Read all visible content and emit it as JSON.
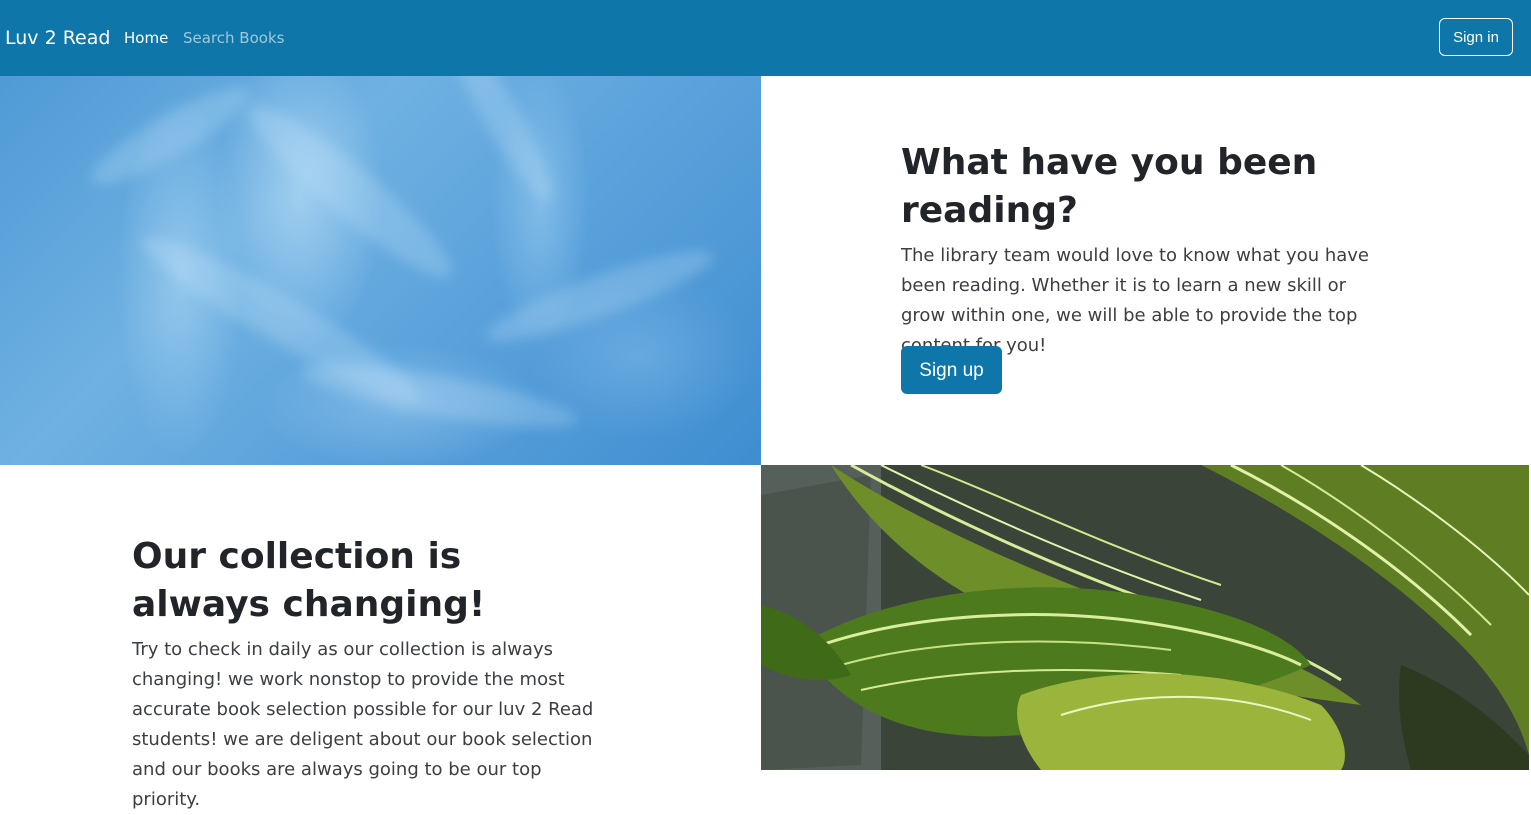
{
  "navbar": {
    "brand": "Luv 2 Read",
    "links": [
      {
        "label": "Home"
      },
      {
        "label": "Search Books"
      }
    ],
    "signin_label": "Sign in",
    "background": "#0e76a8"
  },
  "section1": {
    "title": "What have you been reading?",
    "body": "The library team would love to know what you have been reading. Whether it is to learn a new skill or grow within one, we will be able to provide the top content for you!",
    "button_label": "Sign up",
    "image": "sky-photo"
  },
  "section2": {
    "title": "Our collection is always changing!",
    "body": "Try to check in daily as our collection is always changing! we work nonstop to provide the most accurate book selection possible for our luv 2 Read students! we are deligent about our book selection and our books are always going to be our top priority.",
    "image": "leaves-photo"
  },
  "colors": {
    "primary": "#0e76a8",
    "heading": "#212529",
    "body_text": "#3a3f44"
  }
}
